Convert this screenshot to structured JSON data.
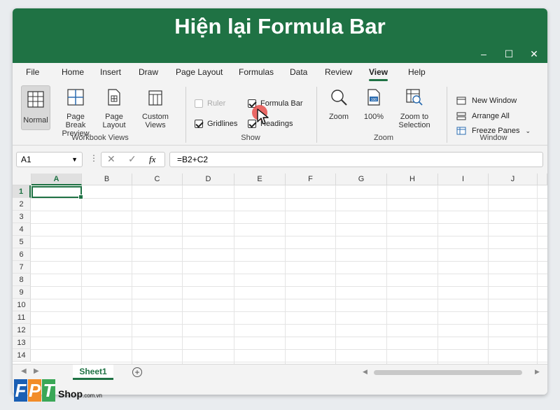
{
  "banner_title": "Hiện lại Formula Bar",
  "window_buttons": {
    "minimize": "–",
    "maximize": "☐",
    "close": "✕"
  },
  "tabs": [
    "File",
    "Home",
    "Insert",
    "Draw",
    "Page Layout",
    "Formulas",
    "Data",
    "Review",
    "View",
    "Help"
  ],
  "active_tab": "View",
  "ribbon": {
    "workbook_views": {
      "label": "Workbook Views",
      "buttons": [
        "Normal",
        "Page Break Preview",
        "Page Layout",
        "Custom Views"
      ],
      "selected": "Normal"
    },
    "show": {
      "label": "Show",
      "ruler": {
        "label": "Ruler",
        "checked": false,
        "disabled": true
      },
      "formula_bar": {
        "label": "Formula Bar",
        "checked": true
      },
      "gridlines": {
        "label": "Gridlines",
        "checked": true
      },
      "headings": {
        "label": "Headings",
        "checked": true
      }
    },
    "zoom": {
      "label": "Zoom",
      "buttons": [
        "Zoom",
        "100%",
        "Zoom to Selection"
      ],
      "zoom100_icon_text": "100"
    },
    "window": {
      "label": "Window",
      "items": [
        "New Window",
        "Arrange All",
        "Freeze Panes"
      ]
    }
  },
  "formula_bar": {
    "name_box": "A1",
    "formula": "=B2+C2",
    "fx_label": "fx"
  },
  "columns": [
    "A",
    "B",
    "C",
    "D",
    "E",
    "F",
    "G",
    "H",
    "I",
    "J"
  ],
  "rows": [
    "1",
    "2",
    "3",
    "4",
    "5",
    "6",
    "7",
    "8",
    "9",
    "10",
    "11",
    "12",
    "13",
    "14"
  ],
  "selected_cell": "A1",
  "sheet_tab": "Sheet1",
  "logo": {
    "letters": [
      "F",
      "P",
      "T"
    ],
    "shop": "Shop",
    "domain": ".com.vn"
  },
  "colors": {
    "excel_green": "#1f7244",
    "logo_blue": "#1a5fb4",
    "logo_orange": "#f28c28",
    "logo_green": "#3aa757",
    "click_red": "#e53935"
  }
}
